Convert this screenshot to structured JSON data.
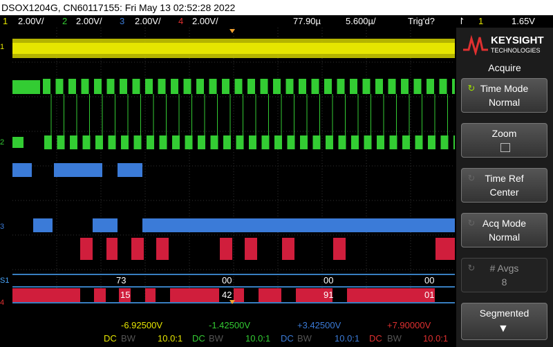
{
  "titlebar": {
    "text": "DSOX1204G, CN60117155: Fri May 13 02:52:28 2022"
  },
  "channels": [
    {
      "num": "1",
      "scale": "2.00V/",
      "color": "#e6e600"
    },
    {
      "num": "2",
      "scale": "2.00V/",
      "color": "#33cc33"
    },
    {
      "num": "3",
      "scale": "2.00V/",
      "color": "#3b7bd8"
    },
    {
      "num": "4",
      "scale": "2.00V/",
      "color": "#e03030"
    }
  ],
  "timebase": {
    "position": "77.90µ",
    "scale": "5.600µ/"
  },
  "trigger": {
    "status": "Trig'd?",
    "icon": "trigger-edge-icon",
    "source": "1",
    "level": "1.65V"
  },
  "markers": {
    "ch1": "1",
    "ch2": "2",
    "ch3": "3",
    "ch4": "4",
    "serial": "S1"
  },
  "decode": {
    "row1": [
      "73",
      "00",
      "00",
      "00"
    ],
    "row2": [
      "15",
      "42",
      "91",
      "01"
    ]
  },
  "offsets": [
    {
      "value": "-6.92500V",
      "coupling": "DC",
      "bw": "BW",
      "probe": "10.0:1",
      "color": "#e6e600"
    },
    {
      "value": "-1.42500V",
      "coupling": "DC",
      "bw": "BW",
      "probe": "10.0:1",
      "color": "#33cc33"
    },
    {
      "value": "+3.42500V",
      "coupling": "DC",
      "bw": "BW",
      "probe": "10.0:1",
      "color": "#3b7bd8"
    },
    {
      "value": "+7.90000V",
      "coupling": "DC",
      "bw": "BW",
      "probe": "10.0:1",
      "color": "#e03030"
    }
  ],
  "side": {
    "brand": "KEYSIGHT",
    "brand_sub": "TECHNOLOGIES",
    "menu_title": "Acquire",
    "buttons": [
      {
        "l1": "Time Mode",
        "l2": "Normal"
      },
      {
        "l1": "Zoom",
        "l2": ""
      },
      {
        "l1": "Time Ref",
        "l2": "Center"
      },
      {
        "l1": "Acq Mode",
        "l2": "Normal"
      },
      {
        "l1": "# Avgs",
        "l2": "8"
      },
      {
        "l1": "Segmented",
        "l2": ""
      }
    ]
  }
}
